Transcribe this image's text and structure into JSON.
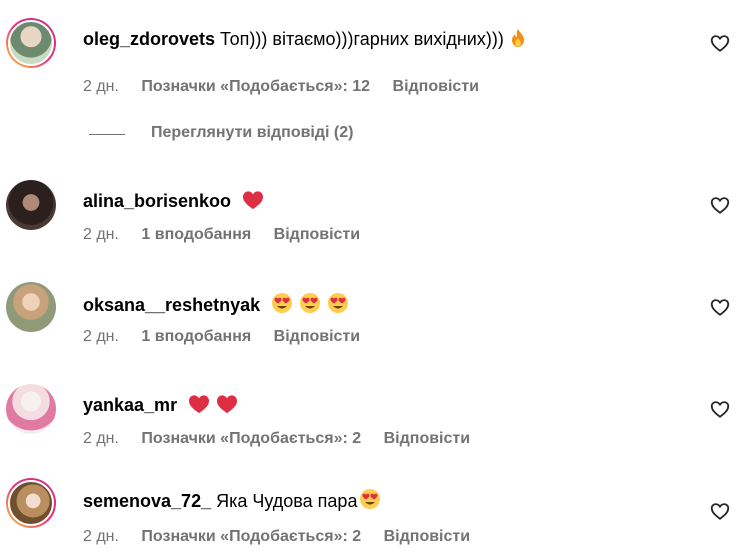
{
  "comments": [
    {
      "username": "oleg_zdorovets",
      "text": "Топ))) вітаємо)))гарних вихідних)))",
      "emojis": [
        "fire"
      ],
      "time": "2 дн.",
      "likes": "Позначки «Подобається»: 12",
      "reply": "Відповісти",
      "story_ring": true,
      "avatar_color": "#9bb6a0"
    },
    {
      "username": "alina_borisenkoo",
      "text": "",
      "emojis": [
        "red-heart"
      ],
      "time": "2 дн.",
      "likes": "1 вподобання",
      "reply": "Відповісти",
      "story_ring": false,
      "avatar_color": "#3a2a28"
    },
    {
      "username": "oksana__reshetnyak",
      "text": "",
      "emojis": [
        "heart-eyes",
        "heart-eyes",
        "heart-eyes"
      ],
      "time": "2 дн.",
      "likes": "1 вподобання",
      "reply": "Відповісти",
      "story_ring": false,
      "avatar_color": "#c9a98a"
    },
    {
      "username": "yankaa_mr",
      "text": "",
      "emojis": [
        "red-heart",
        "red-heart"
      ],
      "time": "2 дн.",
      "likes": "Позначки «Подобається»: 2",
      "reply": "Відповісти",
      "story_ring": false,
      "avatar_color": "#e7c9d2"
    },
    {
      "username": "semenova_72_",
      "text": "Яка Чудова пара",
      "emojis": [
        "heart-eyes"
      ],
      "time": "2 дн.",
      "likes": "Позначки «Подобається»: 2",
      "reply": "Відповісти",
      "story_ring": true,
      "avatar_color": "#c9a073"
    }
  ],
  "view_replies": "Переглянути відповіді (2)",
  "colors": {
    "secondary_text": "#737373",
    "heart_red": "#ff3040",
    "emoji_yellow": "#ffcc4d"
  }
}
